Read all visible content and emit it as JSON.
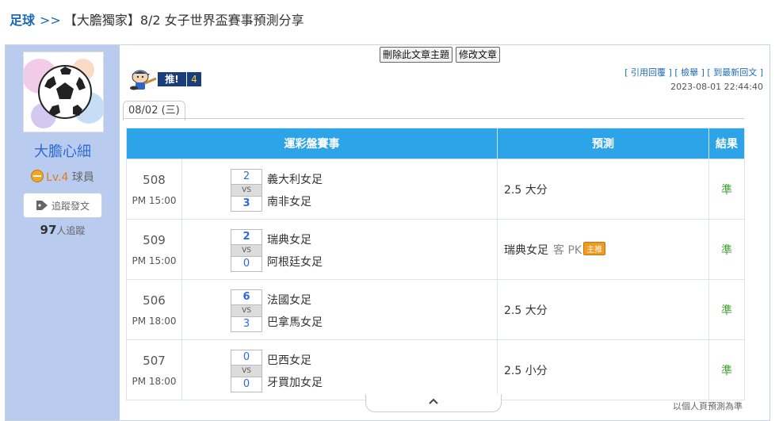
{
  "breadcrumb": {
    "category": "足球",
    "separator": ">>",
    "title": "【大膽獨家】8/2 女子世界盃賽事預測分享"
  },
  "author": {
    "name": "大膽心細",
    "level": "Lv.4",
    "rank": "球員",
    "follow_label": "追蹤發文",
    "follower_count": "97",
    "follower_suffix": "人追蹤"
  },
  "toolbar": {
    "delete_label": "刪除此文章主題",
    "edit_label": "修改文章"
  },
  "push": {
    "label": "推!",
    "count": "4"
  },
  "links": {
    "quote": "引用回覆",
    "report": "檢舉",
    "latest": "到最新回文"
  },
  "timestamp": "2023-08-01 22:44:40",
  "date_tab": "08/02 (三)",
  "table": {
    "headers": [
      "運彩盤賽事",
      "預測",
      "結果"
    ],
    "vs_label": "VS",
    "rows": [
      {
        "id": "508",
        "time": "PM 15:00",
        "home_score": "2",
        "away_score": "3",
        "home": "義大利女足",
        "away": "南非女足",
        "prediction": "2.5 大分",
        "result": "準"
      },
      {
        "id": "509",
        "time": "PM 15:00",
        "home_score": "2",
        "away_score": "0",
        "home": "瑞典女足",
        "away": "阿根廷女足",
        "prediction": "瑞典女足",
        "prediction_extra": "客 PK",
        "prediction_badge": "主推",
        "result": "準"
      },
      {
        "id": "506",
        "time": "PM 18:00",
        "home_score": "6",
        "away_score": "3",
        "home": "法國女足",
        "away": "巴拿馬女足",
        "prediction": "2.5 大分",
        "result": "準"
      },
      {
        "id": "507",
        "time": "PM 18:00",
        "home_score": "0",
        "away_score": "0",
        "home": "巴西女足",
        "away": "牙買加女足",
        "prediction": "2.5 小分",
        "result": "準"
      }
    ]
  },
  "footer_note": "以個人頁預測為準",
  "colors": {
    "header_blue": "#2ea4e8",
    "sidebar_bg": "#b9ccf0",
    "result_green": "#3aa62f",
    "badge_orange": "#f29a1f"
  }
}
